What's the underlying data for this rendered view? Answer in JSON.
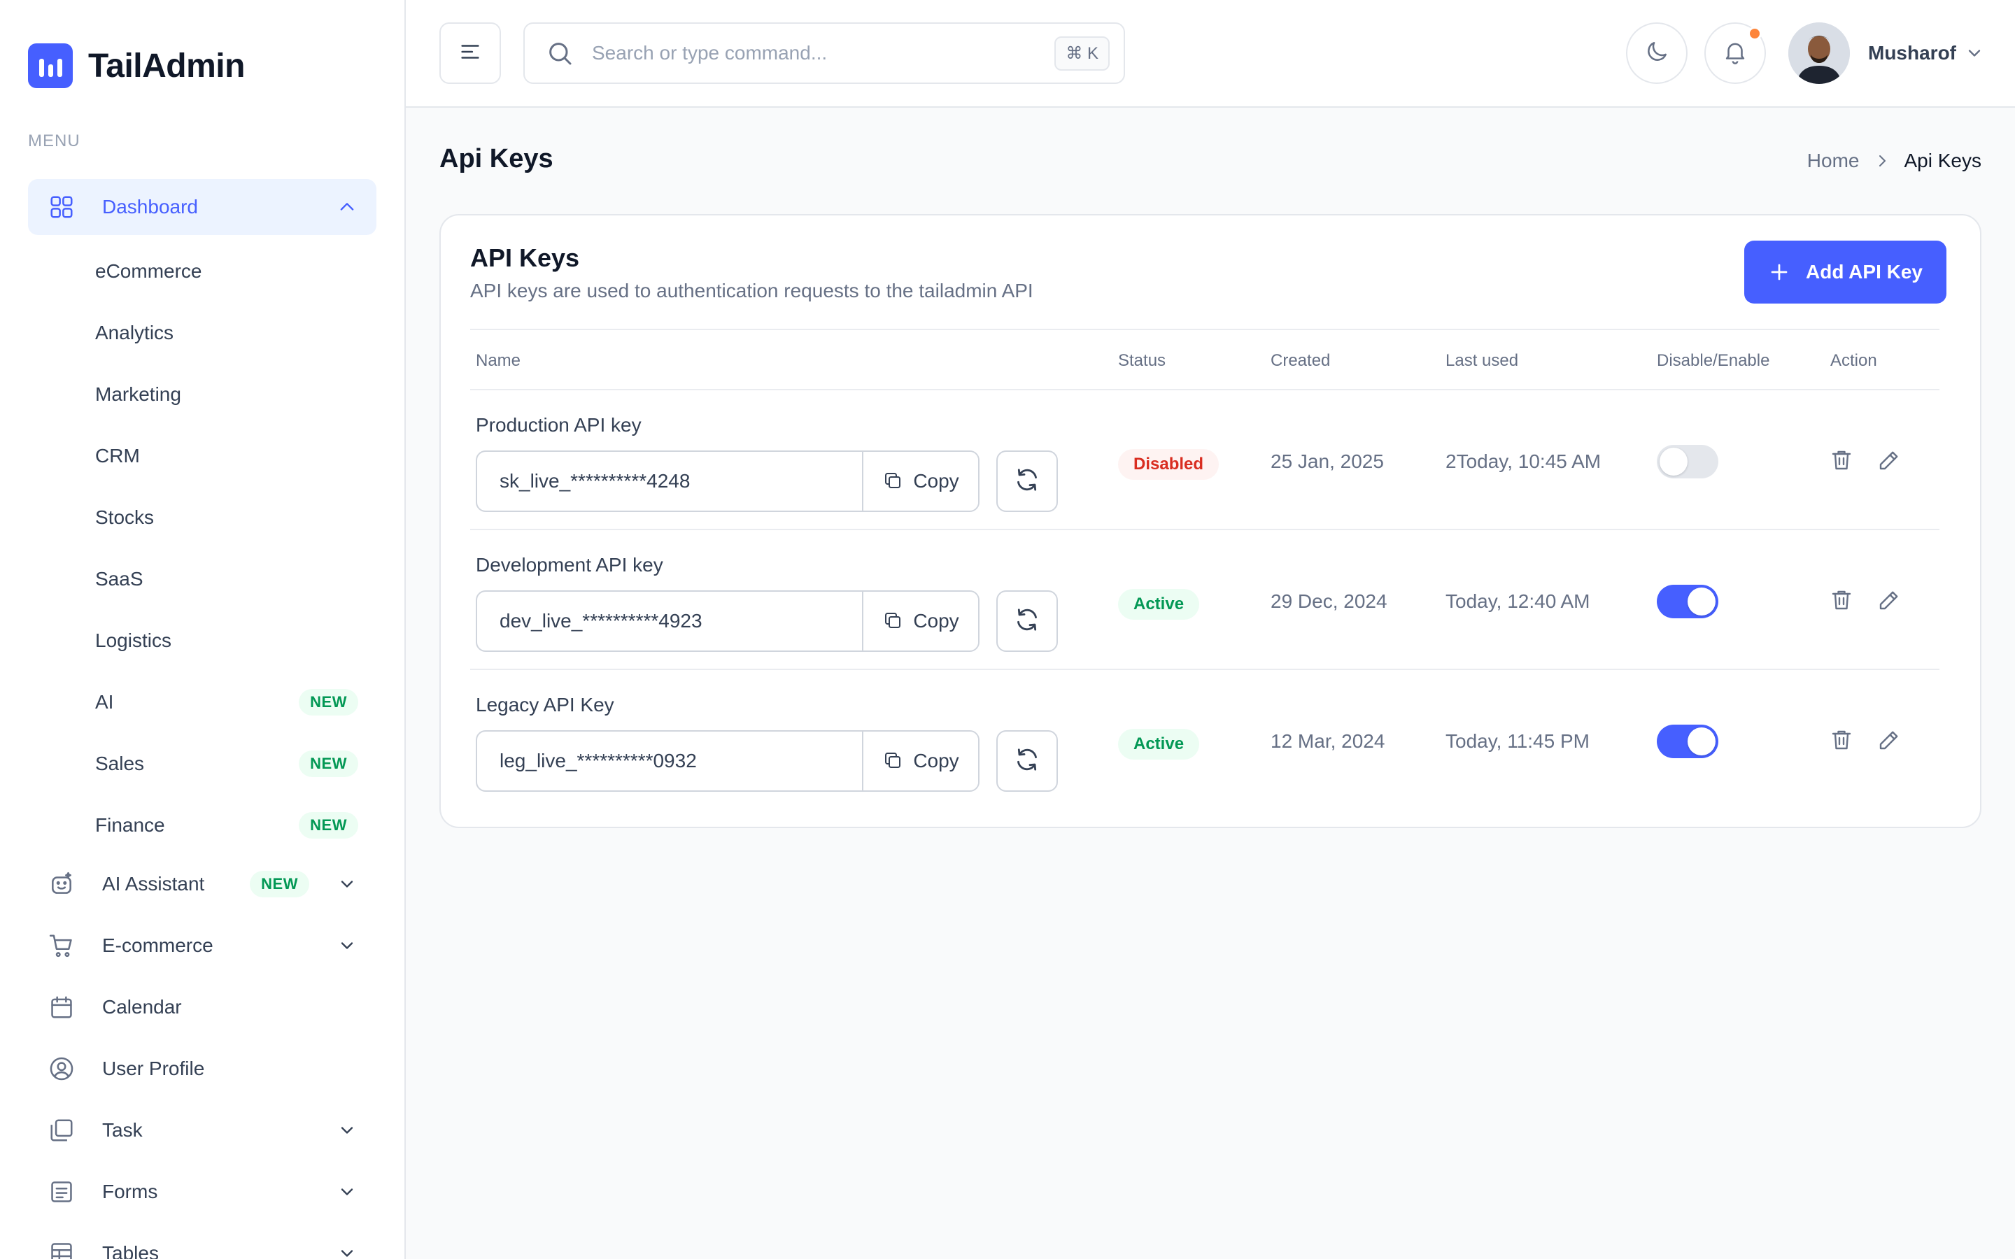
{
  "brand": {
    "name": "TailAdmin",
    "color": "#465fff"
  },
  "sidebar": {
    "menu_label": "MENU",
    "dashboard": {
      "label": "Dashboard",
      "icon": "grid-icon",
      "expanded": true,
      "children": [
        {
          "label": "eCommerce",
          "badge": ""
        },
        {
          "label": "Analytics",
          "badge": ""
        },
        {
          "label": "Marketing",
          "badge": ""
        },
        {
          "label": "CRM",
          "badge": ""
        },
        {
          "label": "Stocks",
          "badge": ""
        },
        {
          "label": "SaaS",
          "badge": ""
        },
        {
          "label": "Logistics",
          "badge": ""
        },
        {
          "label": "AI",
          "badge": "NEW"
        },
        {
          "label": "Sales",
          "badge": "NEW"
        },
        {
          "label": "Finance",
          "badge": "NEW"
        }
      ]
    },
    "items": [
      {
        "label": "AI Assistant",
        "badge": "NEW",
        "icon": "robot-icon",
        "has_children": true
      },
      {
        "label": "E-commerce",
        "badge": "",
        "icon": "cart-icon",
        "has_children": true
      },
      {
        "label": "Calendar",
        "badge": "",
        "icon": "calendar-icon",
        "has_children": false
      },
      {
        "label": "User Profile",
        "badge": "",
        "icon": "user-circle-icon",
        "has_children": false
      },
      {
        "label": "Task",
        "badge": "",
        "icon": "task-icon",
        "has_children": true
      },
      {
        "label": "Forms",
        "badge": "",
        "icon": "form-icon",
        "has_children": true
      },
      {
        "label": "Tables",
        "badge": "",
        "icon": "table-icon",
        "has_children": true
      }
    ]
  },
  "header": {
    "search_placeholder": "Search or type command...",
    "shortcut": "⌘ K",
    "user_name": "Musharof",
    "notification_dot": true
  },
  "page": {
    "title": "Api Keys",
    "breadcrumb": {
      "home": "Home",
      "current": "Api Keys"
    }
  },
  "card": {
    "title": "API Keys",
    "subtitle": "API keys are used to authentication requests to the tailadmin API",
    "add_button": "Add API Key",
    "columns": [
      "Name",
      "Status",
      "Created",
      "Last used",
      "Disable/Enable",
      "Action"
    ],
    "copy_label": "Copy",
    "rows": [
      {
        "name": "Production API key",
        "key": "sk_live_**********4248",
        "status": "Disabled",
        "status_type": "disabled",
        "created": "25 Jan, 2025",
        "last_used": "2Today, 10:45 AM",
        "enabled": false
      },
      {
        "name": "Development API key",
        "key": "dev_live_**********4923",
        "status": "Active",
        "status_type": "active",
        "created": "29 Dec, 2024",
        "last_used": "Today, 12:40 AM",
        "enabled": true
      },
      {
        "name": "Legacy API Key",
        "key": "leg_live_**********0932",
        "status": "Active",
        "status_type": "active",
        "created": "12 Mar, 2024",
        "last_used": "Today, 11:45 PM",
        "enabled": true
      }
    ]
  },
  "colors": {
    "accent": "#465fff",
    "active": "#039855",
    "disabled": "#d92d20",
    "notification": "#fd853a"
  }
}
